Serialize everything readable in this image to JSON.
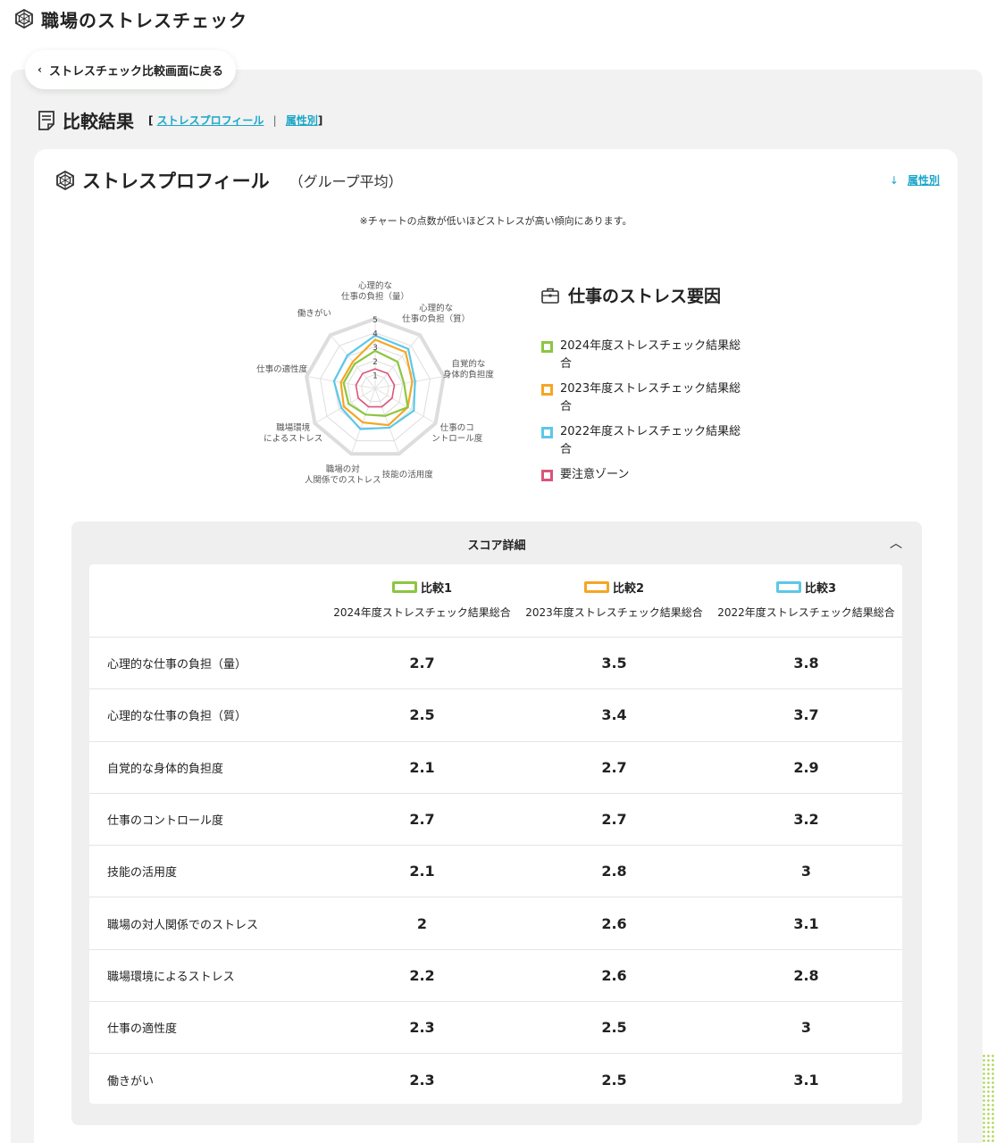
{
  "app": {
    "title": "職場のストレスチェック"
  },
  "back_button": {
    "label": "ストレスチェック比較画面に戻る"
  },
  "section": {
    "title": "比較結果",
    "bracket_open": "[",
    "bracket_close": "]",
    "links": [
      "ストレスプロフィール",
      "属性別"
    ],
    "separator": "|"
  },
  "card": {
    "title": "ストレスプロフィール",
    "subtitle": "（グループ平均）",
    "attr_link": {
      "arrow": "↓",
      "label": "属性別"
    },
    "note": "※チャートの点数が低いほどストレスが高い傾向にあります。"
  },
  "colors": {
    "series1": "#8cc63f",
    "series2": "#f5a623",
    "series3": "#5bc8e8",
    "caution": "#d9557a",
    "link": "#1ba6c9"
  },
  "chart_data": {
    "type": "radar",
    "rmax": 5,
    "ticks": [
      "1",
      "2",
      "3",
      "4",
      "5"
    ],
    "axes": [
      [
        "心理的な",
        "仕事の負担（量）"
      ],
      [
        "心理的な",
        "仕事の負担（質）"
      ],
      [
        "自覚的な",
        "身体的負担度"
      ],
      [
        "仕事のコ",
        "ントロール度"
      ],
      [
        "技能の活用度"
      ],
      [
        "職場の対",
        "人関係でのストレス"
      ],
      [
        "職場環境",
        "によるストレス"
      ],
      [
        "仕事の適性度"
      ],
      [
        "働きがい"
      ]
    ],
    "series": [
      {
        "name": "2024年度ストレスチェック結果総合",
        "color": "#8cc63f",
        "values": [
          2.7,
          2.5,
          2.1,
          2.7,
          2.1,
          2.0,
          2.2,
          2.3,
          2.3
        ]
      },
      {
        "name": "2023年度ストレスチェック結果総合",
        "color": "#f5a623",
        "values": [
          3.5,
          3.4,
          2.7,
          2.7,
          2.8,
          2.6,
          2.6,
          2.5,
          2.5
        ]
      },
      {
        "name": "2022年度ストレスチェック結果総合",
        "color": "#5bc8e8",
        "values": [
          3.8,
          3.7,
          2.9,
          3.2,
          3.0,
          3.1,
          2.8,
          3.0,
          3.1
        ]
      },
      {
        "name": "要注意ゾーン",
        "color": "#d9557a",
        "values": [
          1.4,
          1.4,
          1.4,
          1.4,
          1.4,
          1.4,
          1.4,
          1.4,
          1.4
        ]
      }
    ]
  },
  "legend": {
    "title": "仕事のストレス要因",
    "items": [
      {
        "label": "2024年度ストレスチェック結果総合",
        "color": "#8cc63f"
      },
      {
        "label": "2023年度ストレスチェック結果総合",
        "color": "#f5a623"
      },
      {
        "label": "2022年度ストレスチェック結果総合",
        "color": "#5bc8e8"
      },
      {
        "label": "要注意ゾーン",
        "color": "#d9557a"
      }
    ]
  },
  "score_detail": {
    "title": "スコア詳細",
    "collapse_icon": "︿",
    "columns": [
      {
        "label": "比較1",
        "name": "2024年度ストレスチェック結果総合",
        "color": "#8cc63f"
      },
      {
        "label": "比較2",
        "name": "2023年度ストレスチェック結果総合",
        "color": "#f5a623"
      },
      {
        "label": "比較3",
        "name": "2022年度ストレスチェック結果総合",
        "color": "#5bc8e8"
      }
    ],
    "rows": [
      {
        "label": "心理的な仕事の負担（量）",
        "values": [
          "2.7",
          "3.5",
          "3.8"
        ]
      },
      {
        "label": "心理的な仕事の負担（質）",
        "values": [
          "2.5",
          "3.4",
          "3.7"
        ]
      },
      {
        "label": "自覚的な身体的負担度",
        "values": [
          "2.1",
          "2.7",
          "2.9"
        ]
      },
      {
        "label": "仕事のコントロール度",
        "values": [
          "2.7",
          "2.7",
          "3.2"
        ]
      },
      {
        "label": "技能の活用度",
        "values": [
          "2.1",
          "2.8",
          "3"
        ]
      },
      {
        "label": "職場の対人関係でのストレス",
        "values": [
          "2",
          "2.6",
          "3.1"
        ]
      },
      {
        "label": "職場環境によるストレス",
        "values": [
          "2.2",
          "2.6",
          "2.8"
        ]
      },
      {
        "label": "仕事の適性度",
        "values": [
          "2.3",
          "2.5",
          "3"
        ]
      },
      {
        "label": "働きがい",
        "values": [
          "2.3",
          "2.5",
          "3.1"
        ]
      }
    ]
  }
}
